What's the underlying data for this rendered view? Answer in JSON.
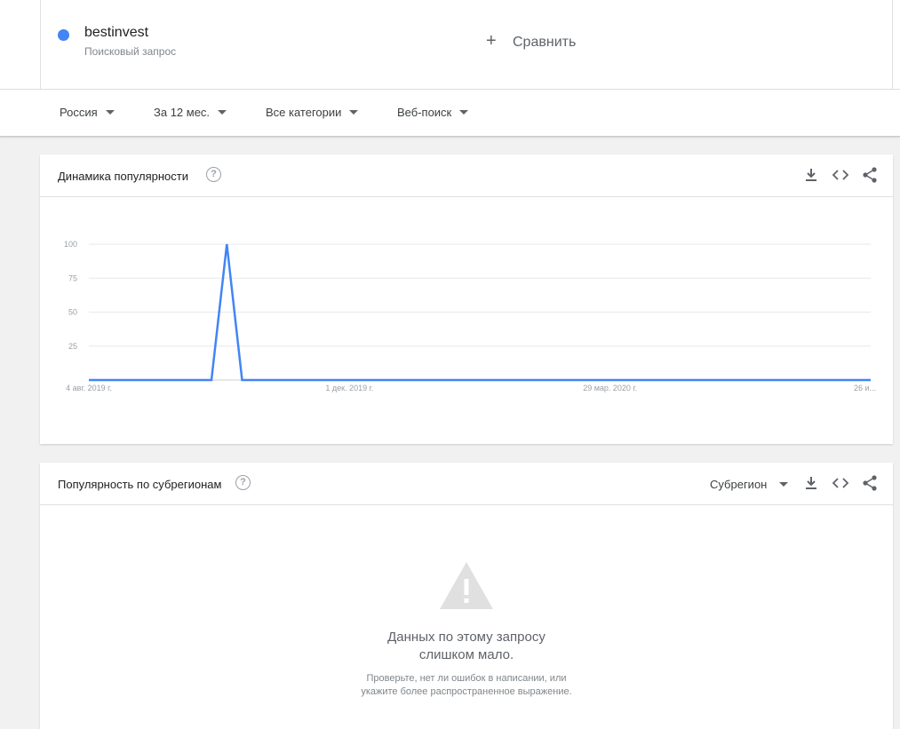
{
  "term": {
    "name": "bestinvest",
    "subtitle": "Поисковый запрос",
    "color": "#4285f4"
  },
  "compare": {
    "icon": "plus-icon",
    "label": "Сравнить"
  },
  "filters": {
    "region": "Россия",
    "period": "За 12 мес.",
    "category": "Все категории",
    "search_type": "Веб-поиск"
  },
  "interest_card": {
    "title": "Динамика популярности",
    "help_icon": "?",
    "icons": [
      "download-icon",
      "embed-icon",
      "share-icon"
    ]
  },
  "chart_data": {
    "type": "line",
    "title": "Динамика популярности",
    "xlabel": "",
    "ylabel": "",
    "ylim": [
      0,
      100
    ],
    "yticks": [
      "100",
      "75",
      "50",
      "25"
    ],
    "xticks": [
      "4 авг. 2019 г.",
      "1 дек. 2019 г.",
      "29 мар. 2020 г.",
      "26 и..."
    ],
    "grid": true,
    "series": [
      {
        "name": "bestinvest",
        "color": "#4285f4",
        "x": [
          "2019-08-04",
          "2019-08-11",
          "2019-08-18",
          "2019-08-25",
          "2019-09-01",
          "2019-09-08",
          "2019-09-15",
          "2019-09-22",
          "2019-09-29",
          "2019-10-06",
          "2019-10-13",
          "2019-10-20",
          "2019-10-27",
          "2019-11-03",
          "2019-11-10",
          "2019-11-17",
          "2019-11-24",
          "2019-12-01",
          "2019-12-08",
          "2019-12-15",
          "2019-12-22",
          "2019-12-29",
          "2020-01-05",
          "2020-01-12",
          "2020-01-19",
          "2020-01-26",
          "2020-02-02",
          "2020-02-09",
          "2020-02-16",
          "2020-02-23",
          "2020-03-01",
          "2020-03-08",
          "2020-03-15",
          "2020-03-22",
          "2020-03-29",
          "2020-04-05",
          "2020-04-12",
          "2020-04-19",
          "2020-04-26",
          "2020-05-03",
          "2020-05-10",
          "2020-05-17",
          "2020-05-24",
          "2020-05-31",
          "2020-06-07",
          "2020-06-14",
          "2020-06-21",
          "2020-06-28",
          "2020-07-05",
          "2020-07-12",
          "2020-07-19",
          "2020-07-26"
        ],
        "values": [
          0,
          0,
          0,
          0,
          0,
          0,
          0,
          0,
          0,
          100,
          0,
          0,
          0,
          0,
          0,
          0,
          0,
          0,
          0,
          0,
          0,
          0,
          0,
          0,
          0,
          0,
          0,
          0,
          0,
          0,
          0,
          0,
          0,
          0,
          0,
          0,
          0,
          0,
          0,
          0,
          0,
          0,
          0,
          0,
          0,
          0,
          0,
          0,
          0,
          0,
          0,
          0
        ]
      }
    ]
  },
  "region_card": {
    "title": "Популярность по субрегионам",
    "help_icon": "?",
    "select_label": "Субрегион",
    "icons": [
      "download-icon",
      "embed-icon",
      "share-icon"
    ],
    "warning_icon": "warning-icon",
    "empty_title_line1": "Данных по этому запросу",
    "empty_title_line2": "слишком мало.",
    "empty_sub_line1": "Проверьте, нет ли ошибок в написании, или",
    "empty_sub_line2": "укажите более распространенное выражение."
  }
}
